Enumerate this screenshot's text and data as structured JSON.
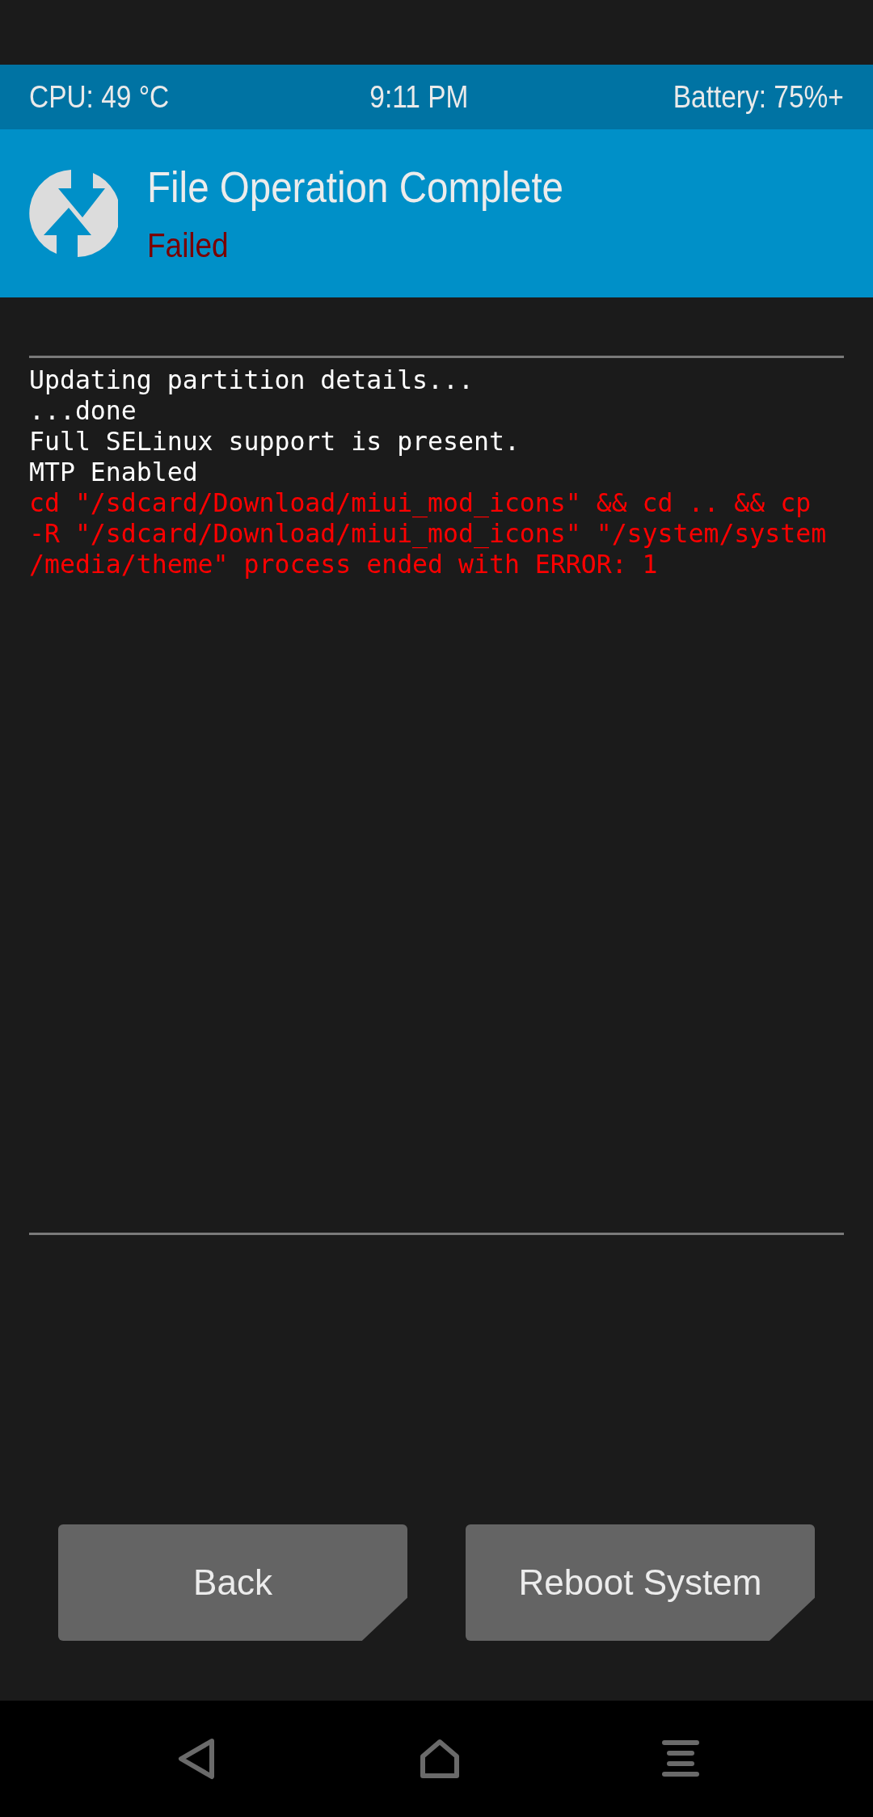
{
  "status_bar": {
    "cpu": "CPU: 49 °C",
    "time": "9:11 PM",
    "battery": "Battery: 75%+"
  },
  "header": {
    "title": "File Operation Complete",
    "status": "Failed",
    "kind": "error"
  },
  "console": [
    {
      "text": "Updating partition details...",
      "kind": "info"
    },
    {
      "text": "...done",
      "kind": "info"
    },
    {
      "text": "Full SELinux support is present.",
      "kind": "info"
    },
    {
      "text": "MTP Enabled",
      "kind": "info"
    },
    {
      "text": "cd \"/sdcard/Download/miui_mod_icons\" && cd .. && cp",
      "kind": "error"
    },
    {
      "text": "-R \"/sdcard/Download/miui_mod_icons\" \"/system/system",
      "kind": "error"
    },
    {
      "text": "/media/theme\" process ended with ERROR: 1",
      "kind": "error"
    }
  ],
  "buttons": [
    "Back",
    "Reboot System"
  ]
}
